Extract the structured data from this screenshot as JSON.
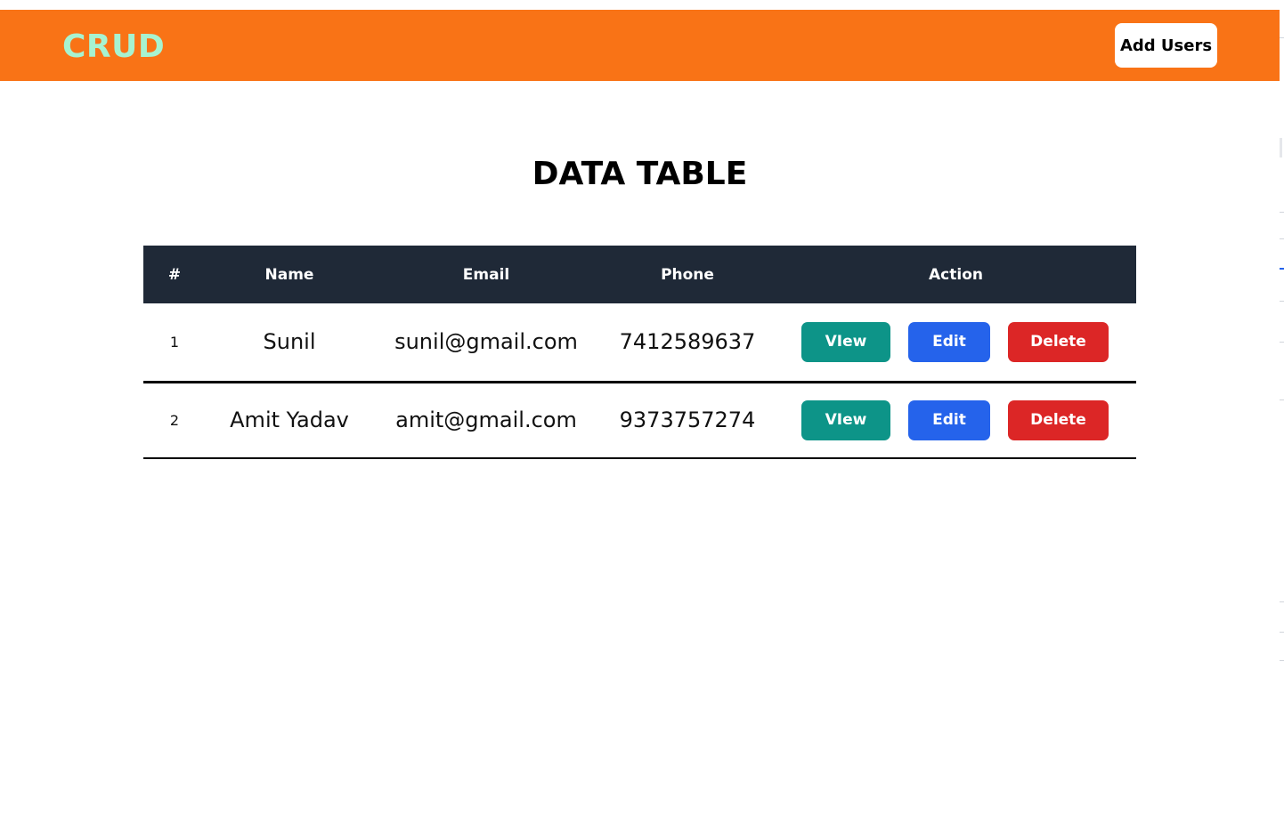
{
  "navbar": {
    "brand": "CRUD",
    "add_users_label": "Add Users"
  },
  "page": {
    "title": "DATA TABLE"
  },
  "table": {
    "headers": [
      "#",
      "Name",
      "Email",
      "Phone",
      "Action"
    ],
    "rows": [
      {
        "num": "1",
        "name": "Sunil",
        "email": "sunil@gmail.com",
        "phone": "7412589637"
      },
      {
        "num": "2",
        "name": "Amit Yadav",
        "email": "amit@gmail.com",
        "phone": "9373757274"
      }
    ],
    "actions": {
      "view": "VIew",
      "edit": "Edit",
      "delete": "Delete"
    }
  },
  "colors": {
    "navbar": "#f97316",
    "brand": "#a7f3d0",
    "table_header": "#1f2937",
    "view": "#0d9488",
    "edit": "#2563eb",
    "delete": "#dc2626"
  }
}
